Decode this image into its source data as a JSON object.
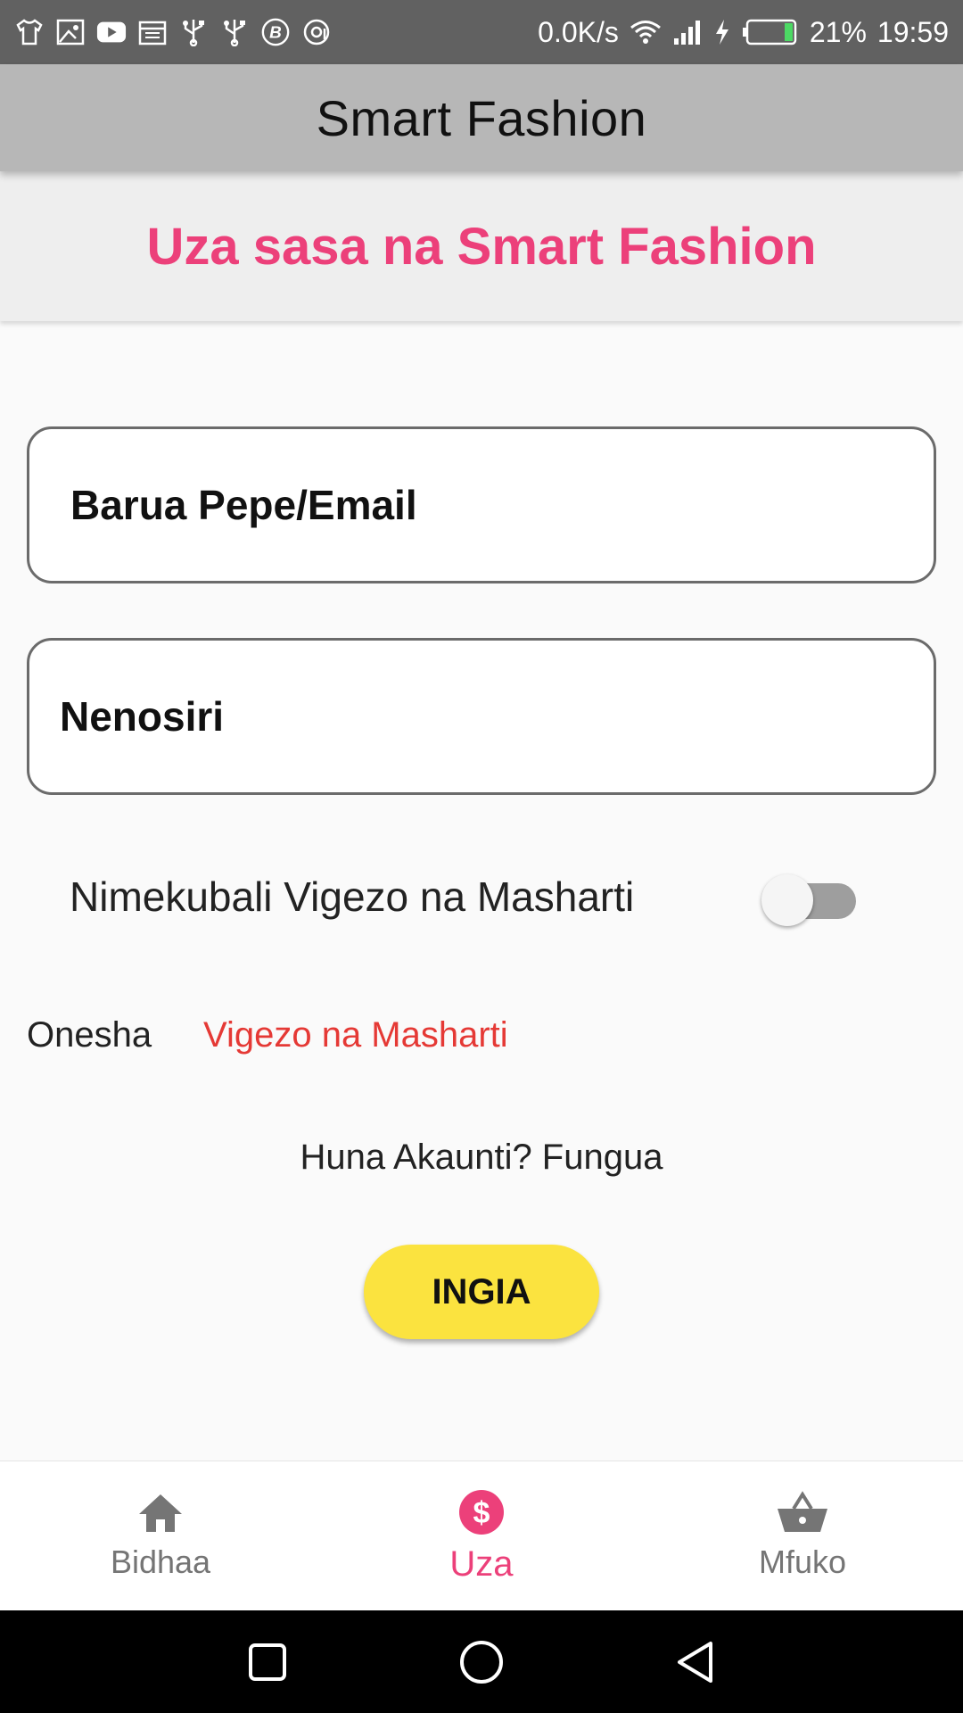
{
  "status_bar": {
    "network_speed": "0.0K/s",
    "battery_percent": "21%",
    "battery_level": 0.21,
    "time": "19:59",
    "icons": [
      "tshirt-icon",
      "image-icon",
      "youtube-icon",
      "calendar-icon",
      "usb-icon",
      "usb-icon",
      "b-badge-icon",
      "at-sign-icon",
      "wifi-icon",
      "signal-icon",
      "charging-icon",
      "battery-icon"
    ]
  },
  "app_bar": {
    "title": "Smart Fashion"
  },
  "banner": {
    "text": "Uza sasa na Smart Fashion"
  },
  "form": {
    "email_placeholder": "Barua Pepe/Email",
    "password_placeholder": "Nenosiri",
    "terms_toggle_label": "Nimekubali Vigezo na Masharti",
    "terms_toggle_on": false,
    "show_label": "Onesha",
    "terms_link": "Vigezo na Masharti",
    "signup_text": "Huna Akaunti? Fungua",
    "login_label": "INGIA"
  },
  "bottom_nav": {
    "items": [
      {
        "label": "Bidhaa",
        "icon": "home-icon",
        "active": false
      },
      {
        "label": "Uza",
        "icon": "dollar-icon",
        "active": true
      },
      {
        "label": "Mfuko",
        "icon": "basket-icon",
        "active": false
      }
    ]
  },
  "colors": {
    "accent": "#ec407a",
    "link": "#e53935",
    "button": "#fbe33f",
    "app_bar": "#b7b7b7",
    "status_bar": "#616161"
  }
}
